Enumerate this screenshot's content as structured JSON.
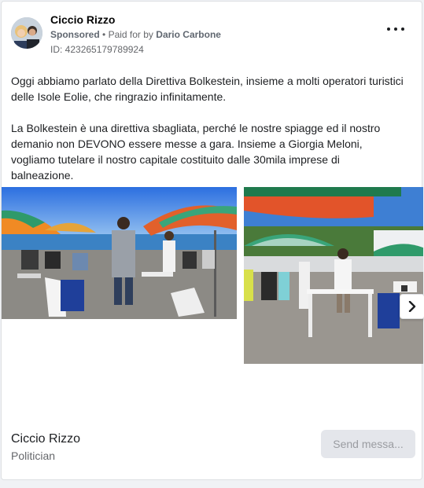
{
  "ad": {
    "page_name": "Ciccio Rizzo",
    "sponsored_label": "Sponsored",
    "paid_for_prefix": "Paid for by",
    "payer": "Dario Carbone",
    "ad_id": "ID: 423265179789924",
    "more_icon": "more-horizontal-icon"
  },
  "body": {
    "paragraph1": "Oggi abbiamo parlato della Direttiva Bolkestein, insieme a molti operatori turistici delle Isole Eolie, che ringrazio infinitamente.",
    "paragraph2": "La Bolkestein è una direttiva sbagliata, perché le nostre spiagge ed il nostro demanio non DEVONO essere messe a gara. Insieme a Giorgia Meloni, vogliamo tutelare il nostro capitale costituito dalle 30mila imprese di balneazione.",
    "ellipsis": "..."
  },
  "carousel": {
    "next_icon": "chevron-right-icon"
  },
  "footer": {
    "name": "Ciccio Rizzo",
    "category": "Politician",
    "cta_label": "Send messa..."
  }
}
